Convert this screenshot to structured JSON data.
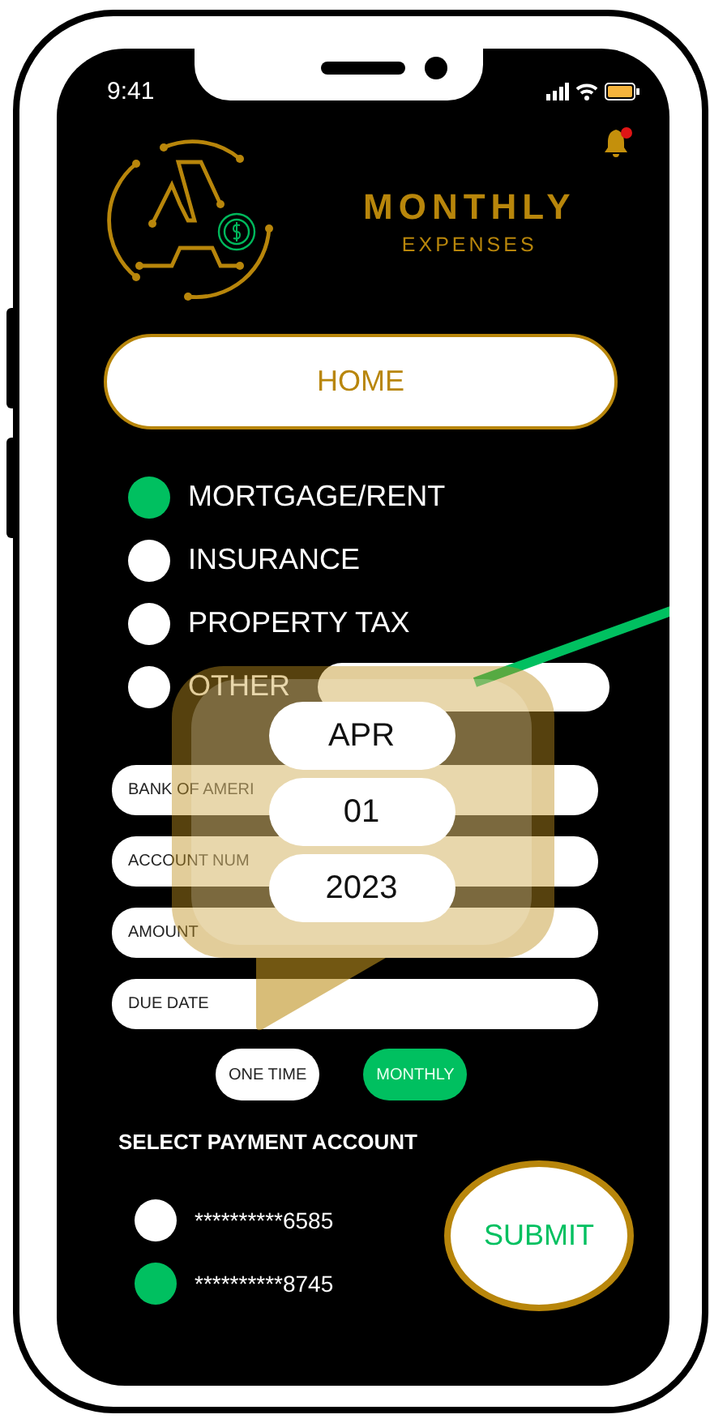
{
  "status_bar": {
    "time": "9:41"
  },
  "header": {
    "title": "MONTHLY",
    "subtitle": "EXPENSES",
    "has_notification": true
  },
  "home_button": "HOME",
  "categories": [
    {
      "label": "MORTGAGE/RENT",
      "selected": true
    },
    {
      "label": "INSURANCE",
      "selected": false
    },
    {
      "label": "PROPERTY TAX",
      "selected": false
    },
    {
      "label": "OTHER",
      "selected": false
    }
  ],
  "fields": [
    {
      "placeholder": "BANK OF AMERI"
    },
    {
      "placeholder": "ACCOUNT NUM"
    },
    {
      "placeholder": "AMOUNT"
    },
    {
      "placeholder": "DUE DATE"
    }
  ],
  "frequency": [
    {
      "label": "ONE TIME",
      "selected": false
    },
    {
      "label": "MONTHLY",
      "selected": true
    }
  ],
  "payment_heading": "SELECT PAYMENT ACCOUNT",
  "accounts": [
    {
      "number": "**********6585",
      "selected": false
    },
    {
      "number": "**********8745",
      "selected": true
    }
  ],
  "submit_button": "SUBMIT",
  "date_picker": {
    "month": "APR",
    "day": "01",
    "year": "2023"
  }
}
